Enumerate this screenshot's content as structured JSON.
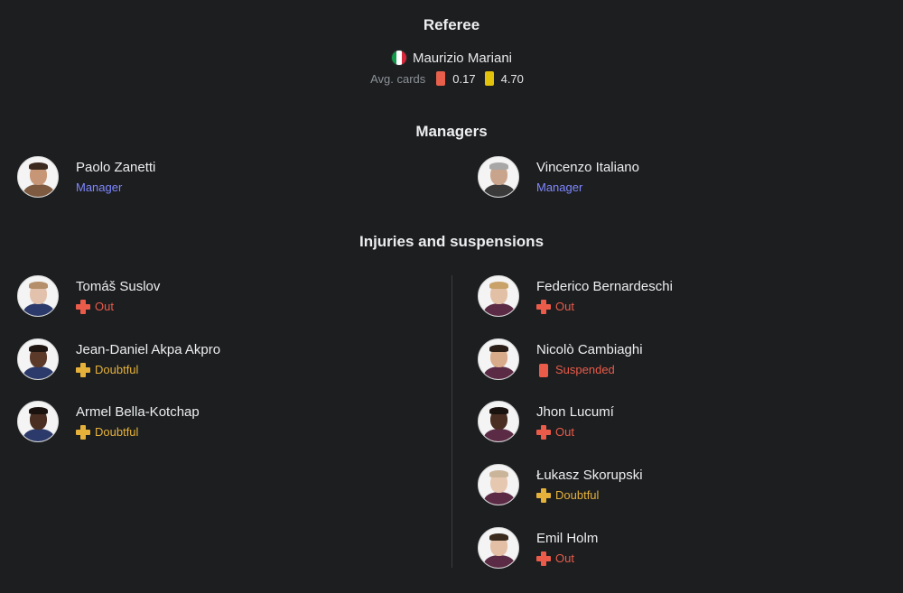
{
  "referee": {
    "title": "Referee",
    "name": "Maurizio Mariani",
    "flag": "italy-flag",
    "avg_cards_label": "Avg. cards",
    "red_avg": "0.17",
    "yellow_avg": "4.70",
    "colors": {
      "red_card": "#e8604c",
      "yellow_card": "#e2c20a"
    }
  },
  "managers": {
    "title": "Managers",
    "home": {
      "name": "Paolo Zanetti",
      "role": "Manager"
    },
    "away": {
      "name": "Vincenzo Italiano",
      "role": "Manager"
    }
  },
  "injuries": {
    "title": "Injuries and suspensions",
    "home": [
      {
        "name": "Tomáš Suslov",
        "status": "Out",
        "type": "out"
      },
      {
        "name": "Jean-Daniel Akpa Akpro",
        "status": "Doubtful",
        "type": "doubtful"
      },
      {
        "name": "Armel Bella-Kotchap",
        "status": "Doubtful",
        "type": "doubtful"
      }
    ],
    "away": [
      {
        "name": "Federico Bernardeschi",
        "status": "Out",
        "type": "out"
      },
      {
        "name": "Nicolò Cambiaghi",
        "status": "Suspended",
        "type": "suspended"
      },
      {
        "name": "Jhon Lucumí",
        "status": "Out",
        "type": "out"
      },
      {
        "name": "Łukasz Skorupski",
        "status": "Doubtful",
        "type": "doubtful"
      },
      {
        "name": "Emil Holm",
        "status": "Out",
        "type": "out"
      }
    ]
  },
  "colors": {
    "background": "#1c1e20",
    "role_text": "#7f87ff",
    "out": "#ea5b4a",
    "doubtful": "#e6b13a"
  }
}
